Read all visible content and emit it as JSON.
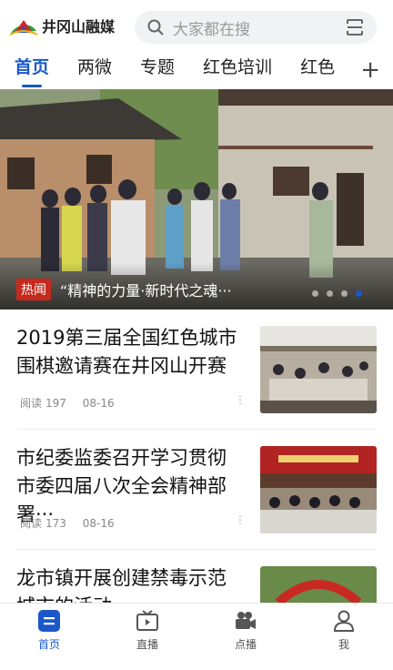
{
  "header": {
    "logo_text": "井冈山融媒",
    "search_placeholder": "大家都在搜"
  },
  "tabs": [
    {
      "label": "首页",
      "active": true
    },
    {
      "label": "两微",
      "active": false
    },
    {
      "label": "专题",
      "active": false
    },
    {
      "label": "红色培训",
      "active": false
    },
    {
      "label": "红色",
      "active": false
    }
  ],
  "banner": {
    "badge": "热闻",
    "title": "“精神的力量·新时代之魂···",
    "slides": 4,
    "active_slide": 4
  },
  "news": [
    {
      "title": "2019第三届全国红色城市围棋邀请赛在井冈山开赛",
      "read_label": "阅读",
      "reads": "197",
      "date": "08-16"
    },
    {
      "title": "市纪委监委召开学习贯彻市委四届八次全会精神部署···",
      "read_label": "阅读",
      "reads": "173",
      "date": "08-16"
    },
    {
      "title": "龙市镇开展创建禁毒示范城市的活动",
      "read_label": "",
      "reads": "",
      "date": ""
    }
  ],
  "navbar": [
    {
      "label": "首页",
      "icon": "home-icon",
      "active": true
    },
    {
      "label": "直播",
      "icon": "live-tv-icon",
      "active": false
    },
    {
      "label": "点播",
      "icon": "video-camera-icon",
      "active": false
    },
    {
      "label": "我",
      "icon": "user-icon",
      "active": false
    }
  ],
  "colors": {
    "accent": "#1a58c9",
    "badge": "#c72a1d"
  }
}
